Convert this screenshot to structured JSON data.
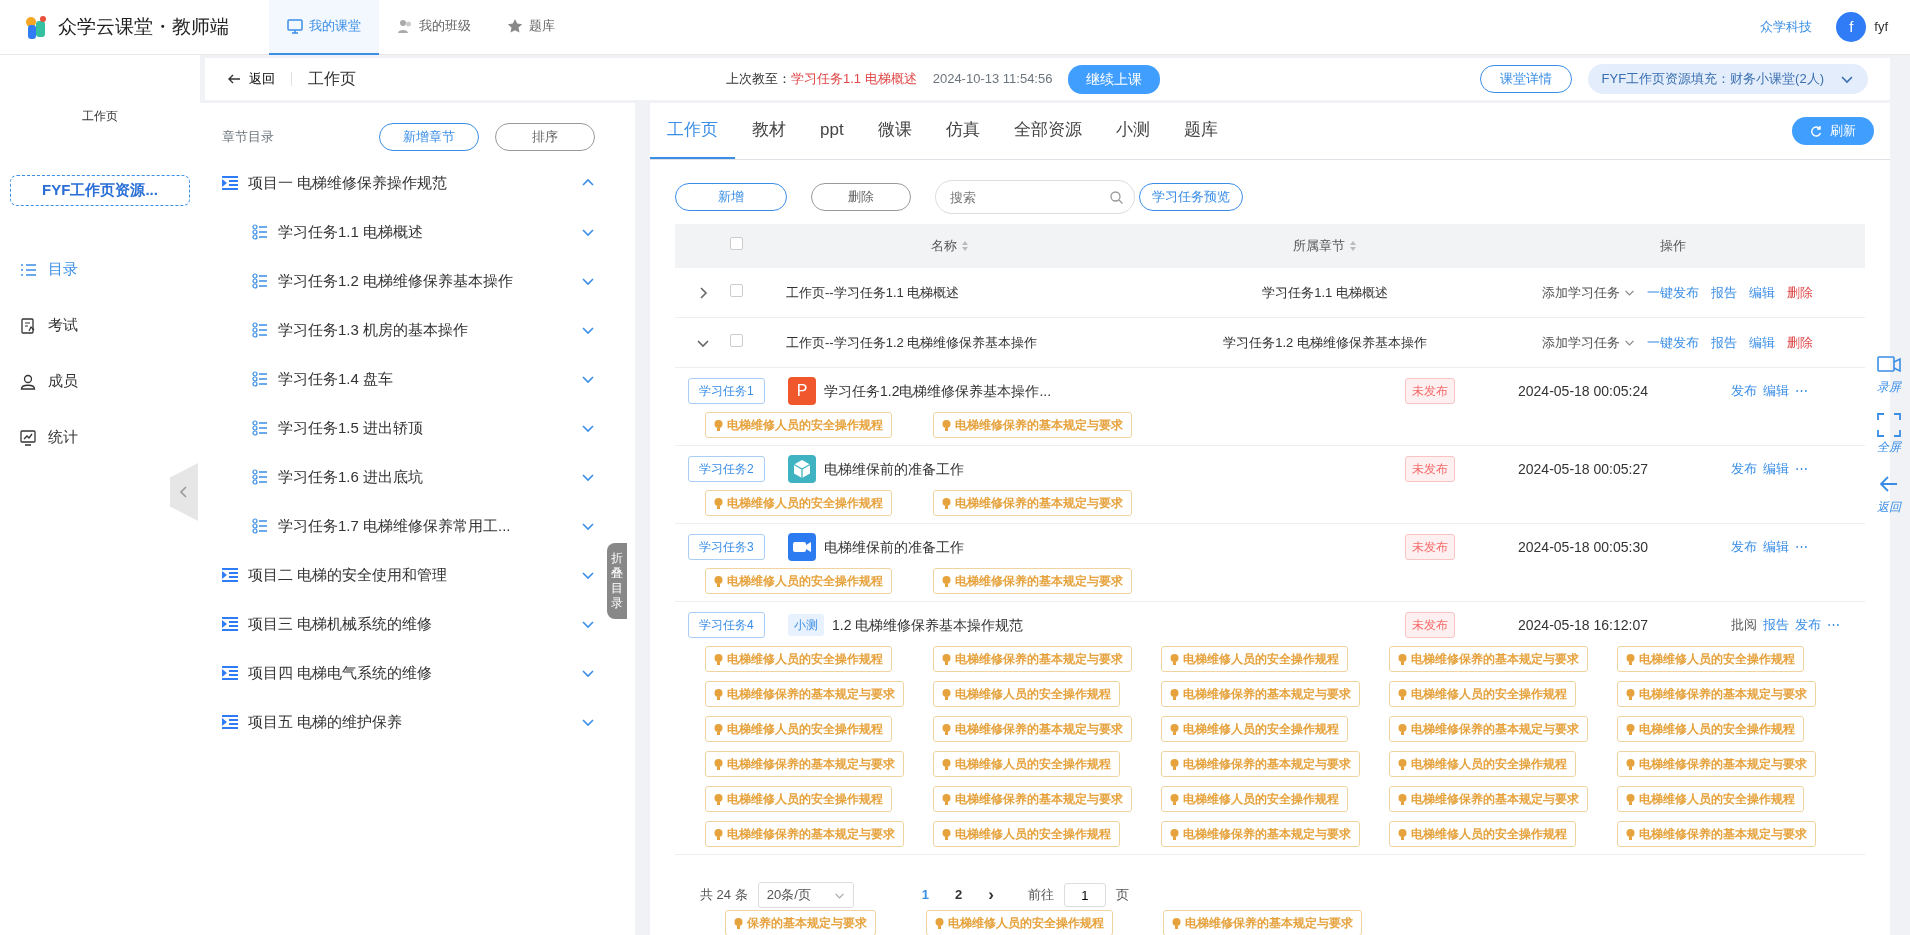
{
  "app": {
    "title": "众学云课堂・教师端",
    "nav": [
      {
        "label": "我的课堂",
        "selected": true
      },
      {
        "label": "我的班级",
        "selected": false
      },
      {
        "label": "题库",
        "selected": false
      }
    ],
    "org": "众学科技",
    "avatar": "f",
    "user": "fyf"
  },
  "sidebar": {
    "title": "工作页",
    "course_button": "FYF工作页资源...",
    "items": [
      {
        "label": "目录",
        "selected": true
      },
      {
        "label": "考试",
        "selected": false
      },
      {
        "label": "成员",
        "selected": false
      },
      {
        "label": "统计",
        "selected": false
      }
    ]
  },
  "header": {
    "back": "返回",
    "page_title": "工作页",
    "last_label": "上次教至：",
    "last_task": "学习任务1.1 电梯概述",
    "last_time": "2024-10-13 11:54:56",
    "continue": "继续上课",
    "details": "课堂详情",
    "class_select": "FYF工作页资源填充：财务小课堂(2人)"
  },
  "chapters": {
    "title": "章节目录",
    "buttons": [
      "新增章节",
      "排序"
    ],
    "collapse_tab": "折叠目录",
    "tree": [
      {
        "label": "项目一 电梯维修保养操作规范",
        "expanded": true,
        "children": [
          {
            "label": "学习任务1.1 电梯概述",
            "expanded": false
          },
          {
            "label": "学习任务1.2 电梯维修保养基本操作",
            "expanded": false
          },
          {
            "label": "学习任务1.3 机房的基本操作",
            "expanded": false
          },
          {
            "label": "学习任务1.4 盘车",
            "expanded": false
          },
          {
            "label": "学习任务1.5 进出轿顶",
            "expanded": false
          },
          {
            "label": "学习任务1.6 进出底坑",
            "expanded": false
          },
          {
            "label": "学习任务1.7 电梯维修保养常用工...",
            "expanded": false
          }
        ]
      },
      {
        "label": "项目二 电梯的安全使用和管理",
        "expanded": false
      },
      {
        "label": "项目三 电梯机械系统的维修",
        "expanded": false
      },
      {
        "label": "项目四 电梯电气系统的维修",
        "expanded": false
      },
      {
        "label": "项目五 电梯的维护保养",
        "expanded": false
      }
    ]
  },
  "main": {
    "tabs": [
      {
        "label": "工作页",
        "selected": true
      },
      {
        "label": "教材",
        "selected": false
      },
      {
        "label": "ppt",
        "selected": false
      },
      {
        "label": "微课",
        "selected": false
      },
      {
        "label": "仿真",
        "selected": false
      },
      {
        "label": "全部资源",
        "selected": false
      },
      {
        "label": "小测",
        "selected": false
      },
      {
        "label": "题库",
        "selected": false
      }
    ],
    "refresh": "刷新",
    "toolbar": {
      "add": "新增",
      "delete": "删除",
      "search_placeholder": "搜索",
      "preview": "学习任务预览"
    },
    "table": {
      "columns": [
        "名称",
        "所属章节",
        "操作"
      ],
      "select_all_checked": false,
      "rows": [
        {
          "name": "工作页--学习任务1.1 电梯概述",
          "chapter": "学习任务1.1 电梯概述",
          "expanded": false,
          "checked": false,
          "actions": [
            {
              "label": "添加学习任务",
              "kind": "dropdown"
            },
            {
              "label": "一键发布",
              "kind": "link"
            },
            {
              "label": "报告",
              "kind": "link"
            },
            {
              "label": "编辑",
              "kind": "link"
            },
            {
              "label": "删除",
              "kind": "danger"
            }
          ]
        },
        {
          "name": "工作页--学习任务1.2 电梯维修保养基本操作",
          "chapter": "学习任务1.2 电梯维修保养基本操作",
          "expanded": true,
          "checked": false,
          "actions": [
            {
              "label": "添加学习任务",
              "kind": "dropdown"
            },
            {
              "label": "一键发布",
              "kind": "link"
            },
            {
              "label": "报告",
              "kind": "link"
            },
            {
              "label": "编辑",
              "kind": "link"
            },
            {
              "label": "删除",
              "kind": "danger"
            }
          ],
          "tasks": [
            {
              "tag": "学习任务1",
              "kind": "ppt",
              "icon_text": "P",
              "title": "学习任务1.2电梯维修保养基本操作...",
              "status": "未发布",
              "time": "2024-05-18 00:05:24",
              "actions": [
                {
                  "label": "发布",
                  "kind": "link"
                },
                {
                  "label": "编辑",
                  "kind": "link"
                },
                {
                  "label": "⋯",
                  "kind": "more"
                }
              ],
              "points": [
                "电梯维修人员的安全操作规程",
                "电梯维修保养的基本规定与要求"
              ]
            },
            {
              "tag": "学习任务2",
              "kind": "cube",
              "title": "电梯维保前的准备工作",
              "status": "未发布",
              "time": "2024-05-18 00:05:27",
              "actions": [
                {
                  "label": "发布",
                  "kind": "link"
                },
                {
                  "label": "编辑",
                  "kind": "link"
                },
                {
                  "label": "⋯",
                  "kind": "more"
                }
              ],
              "points": [
                "电梯维修人员的安全操作规程",
                "电梯维修保养的基本规定与要求"
              ]
            },
            {
              "tag": "学习任务3",
              "kind": "video",
              "title": "电梯维保前的准备工作",
              "status": "未发布",
              "time": "2024-05-18 00:05:30",
              "actions": [
                {
                  "label": "发布",
                  "kind": "link"
                },
                {
                  "label": "编辑",
                  "kind": "link"
                },
                {
                  "label": "⋯",
                  "kind": "more"
                }
              ],
              "points": [
                "电梯维修人员的安全操作规程",
                "电梯维修保养的基本规定与要求"
              ]
            },
            {
              "tag": "学习任务4",
              "kind": "quiz",
              "icon_text": "小测",
              "title": "1.2 电梯维修保养基本操作规范",
              "status": "未发布",
              "time": "2024-05-18 16:12:07",
              "actions": [
                {
                  "label": "批阅",
                  "kind": "plain"
                },
                {
                  "label": "报告",
                  "kind": "link"
                },
                {
                  "label": "发布",
                  "kind": "link"
                },
                {
                  "label": "⋯",
                  "kind": "more"
                }
              ],
              "points": [
                "电梯维修人员的安全操作规程",
                "电梯维修保养的基本规定与要求",
                "电梯维修人员的安全操作规程",
                "电梯维修保养的基本规定与要求",
                "电梯维修人员的安全操作规程",
                "电梯维修保养的基本规定与要求",
                "电梯维修人员的安全操作规程",
                "电梯维修保养的基本规定与要求",
                "电梯维修人员的安全操作规程",
                "电梯维修保养的基本规定与要求",
                "电梯维修人员的安全操作规程",
                "电梯维修保养的基本规定与要求",
                "电梯维修人员的安全操作规程",
                "电梯维修保养的基本规定与要求",
                "电梯维修人员的安全操作规程",
                "电梯维修保养的基本规定与要求",
                "电梯维修人员的安全操作规程",
                "电梯维修保养的基本规定与要求",
                "电梯维修人员的安全操作规程",
                "电梯维修保养的基本规定与要求",
                "电梯维修人员的安全操作规程",
                "电梯维修保养的基本规定与要求",
                "电梯维修人员的安全操作规程",
                "电梯维修保养的基本规定与要求",
                "电梯维修人员的安全操作规程",
                "电梯维修保养的基本规定与要求",
                "电梯维修人员的安全操作规程",
                "电梯维修保养的基本规定与要求",
                "电梯维修人员的安全操作规程",
                "电梯维修保养的基本规定与要求"
              ]
            }
          ]
        }
      ]
    },
    "pagination": {
      "total": "共 24 条",
      "page_size": "20条/页",
      "pages": [
        {
          "label": "1",
          "selected": true
        },
        {
          "label": "2",
          "selected": false
        }
      ],
      "next": "›",
      "goto": "前往",
      "goto_value": "1",
      "goto_unit": "页"
    },
    "tail_points": [
      "保养的基本规定与要求",
      "电梯维修人员的安全操作规程",
      "电梯维修保养的基本规定与要求"
    ]
  },
  "float_tools": [
    {
      "label": "录屏"
    },
    {
      "label": "全屏"
    },
    {
      "label": "返回"
    }
  ]
}
